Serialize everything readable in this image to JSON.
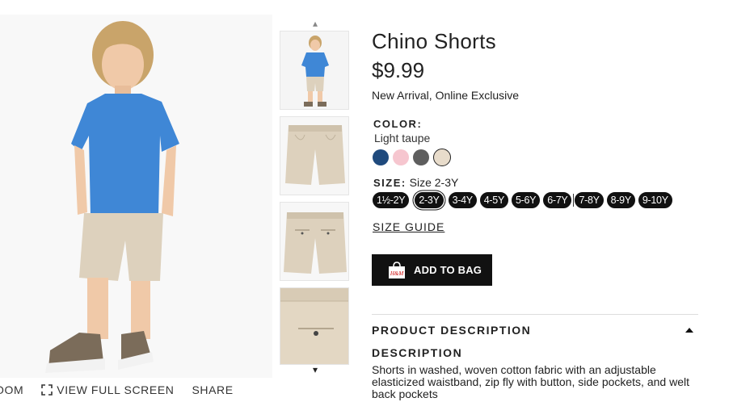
{
  "product": {
    "title": "Chino Shorts",
    "price": "$9.99",
    "badges": "New Arrival, Online Exclusive"
  },
  "image_actions": {
    "zoom_label": "OOM",
    "fullscreen_label": "VIEW FULL SCREEN",
    "share_label": "SHARE"
  },
  "color": {
    "label": "COLOR:",
    "selected_name": "Light taupe",
    "swatches": [
      {
        "name": "navy-blue",
        "hex": "#1f4a7d"
      },
      {
        "name": "light-pink",
        "hex": "#f6c6cf"
      },
      {
        "name": "dark-gray",
        "hex": "#5e5e5e"
      },
      {
        "name": "light-taupe",
        "hex": "#e8dccb",
        "selected": true
      }
    ]
  },
  "size": {
    "label": "SIZE:",
    "selected_text": "Size 2-3Y",
    "options": [
      "1½-2Y",
      "2-3Y",
      "3-4Y",
      "4-5Y",
      "5-6Y",
      "6-7Y",
      "7-8Y",
      "8-9Y",
      "9-10Y"
    ],
    "selected_index": 1,
    "guide_label": "SIZE GUIDE"
  },
  "actions": {
    "add_to_bag": "ADD TO BAG",
    "bag_logo_text": "H&M"
  },
  "description": {
    "section_title": "PRODUCT DESCRIPTION",
    "subheading": "DESCRIPTION",
    "text": "Shorts in washed, woven cotton fabric with an adjustable elasticized waistband, zip fly with button, side pockets, and welt back pockets"
  },
  "colors": {
    "shirt": "#3f87d6",
    "shorts": "#ddd1bd",
    "shoes": "#7b6c5a",
    "hair": "#c9a46a",
    "skin": "#f0c9a8"
  }
}
